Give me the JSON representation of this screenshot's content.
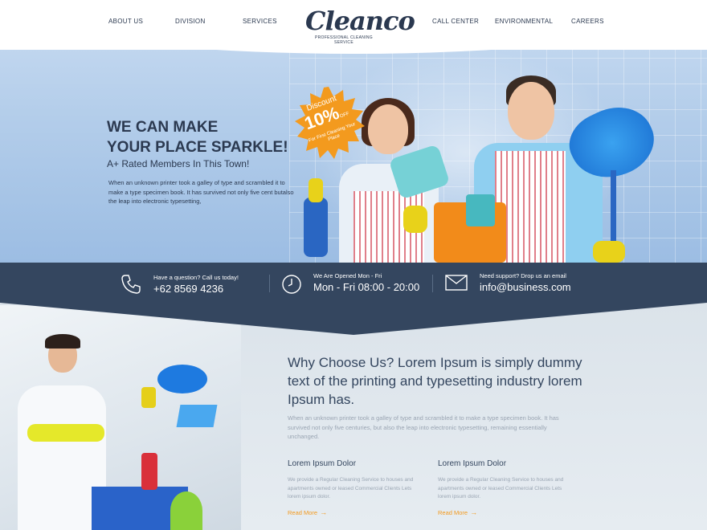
{
  "nav": {
    "items": [
      "ABOUT US",
      "DIVISION",
      "SERVICES",
      "CALL CENTER",
      "ENVIRONMENTAL",
      "CAREERS"
    ],
    "logo": "Cleanco",
    "tagline": "PROFESSIONAL CLEANING SERVICE"
  },
  "hero": {
    "headline_line1": "WE CAN MAKE",
    "headline_line2": "YOUR PLACE SPARKLE!",
    "subheading": "A+ Rated Members In This Town!",
    "body": "When an unknown printer took a galley of type and scrambled it to make a type specimen book. It has survived not only five cent butalso the leap into electronic typesetting,",
    "badge": {
      "line1": "Discount",
      "line2": "10%",
      "line2_suffix": "OFF",
      "line3": "For First Cleaning Your Place"
    }
  },
  "infobar": {
    "phone": {
      "label": "Have a question? Call us today!",
      "value": "+62 8569 4236"
    },
    "hours": {
      "label": "We Are Opened Mon - Fri",
      "value": "Mon - Fri 08:00 - 20:00"
    },
    "email": {
      "label": "Need support? Drop us an email",
      "value": "info@business.com"
    }
  },
  "why": {
    "title": "Why Choose Us? Lorem Ipsum is simply dummy text of the printing and typesetting industry lorem Ipsum has.",
    "body": "When an unknown printer took a galley of type and scrambled it to make a type specimen book. It has survived not only five centuries, but also the leap into electronic typesetting, remaining essentially unchanged.",
    "columns": [
      {
        "title": "Lorem Ipsum Dolor",
        "body": "We provide a Regular Cleaning Service to houses and apartments owned or leased Commercial Clients Lets lorem ipsum dolor.",
        "link": "Read More"
      },
      {
        "title": "Lorem Ipsum Dolor",
        "body": "We provide a Regular Cleaning Service to houses and apartments owned or leased Commercial Clients Lets lorem ipsum dolor.",
        "link": "Read More"
      }
    ]
  },
  "colors": {
    "navy": "#34465f",
    "accent_orange": "#f39a1e",
    "hero_blue": "#b3cdea"
  },
  "icons": [
    "phone-icon",
    "clock-icon",
    "email-icon",
    "arrow-right-icon"
  ]
}
